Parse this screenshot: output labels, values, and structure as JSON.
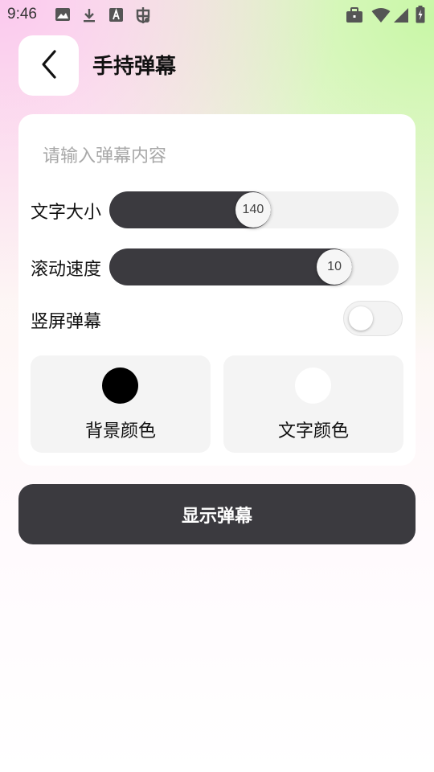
{
  "status_bar": {
    "time": "9:46",
    "left_icons": [
      "image-icon",
      "download-icon",
      "text-a-icon",
      "bug-icon"
    ],
    "right_icons": [
      "briefcase-icon",
      "wifi-icon",
      "signal-icon",
      "battery-charging-icon"
    ]
  },
  "header": {
    "back_icon": "chevron-left-icon",
    "title": "手持弹幕"
  },
  "form": {
    "input_placeholder": "请输入弹幕内容",
    "input_value": "",
    "font_size": {
      "label": "文字大小",
      "value_text": "140",
      "fraction": 0.497
    },
    "scroll_speed": {
      "label": "滚动速度",
      "value_text": "10",
      "fraction": 0.778
    },
    "vertical": {
      "label": "竖屏弹幕",
      "on": false
    },
    "bg_color": {
      "label": "背景颜色",
      "color": "#000000"
    },
    "text_color": {
      "label": "文字颜色",
      "color": "#ffffff"
    }
  },
  "action": {
    "show_label": "显示弹幕"
  },
  "colors": {
    "accent_dark": "#3b3a3f",
    "track": "#f2f2f2",
    "tile": "#f4f4f4"
  }
}
